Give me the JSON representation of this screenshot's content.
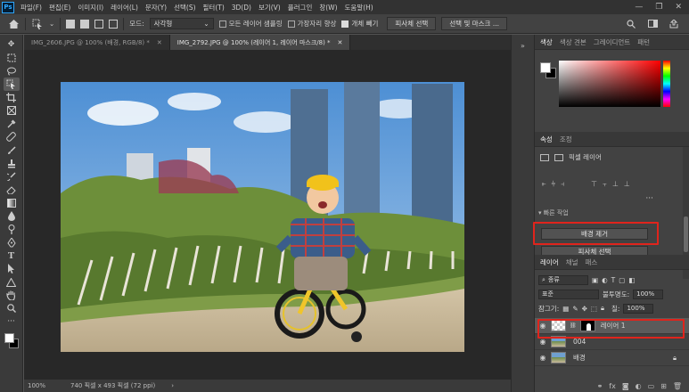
{
  "app": {
    "logo": "Ps"
  },
  "menu": [
    "파일(F)",
    "편집(E)",
    "이미지(I)",
    "레이어(L)",
    "문자(Y)",
    "선택(S)",
    "필터(T)",
    "3D(D)",
    "보기(V)",
    "플러그인",
    "창(W)",
    "도움말(H)"
  ],
  "window_controls": [
    "—",
    "❐",
    "✕"
  ],
  "options": {
    "mode_label": "모드:",
    "mode_value": "사각형",
    "sample_all_layers": "모든 레이어 샘플링",
    "enhance_edges": "가장자리 향상",
    "object_subtract": "개체 빼기",
    "select_subject": "피사체 선택",
    "select_and_mask": "선택 및 마스크 ..."
  },
  "tabs": [
    {
      "label": "IMG_2606.JPG @ 100% (배경, RGB/8) *",
      "close": "✕"
    },
    {
      "label": "IMG_2792.JPG @ 100% (레이어 1, 레이어 마스크/8) *",
      "close": "✕"
    }
  ],
  "status": {
    "zoom": "100%",
    "doc_info": "740 픽셀 x 493 픽셀 (72 ppi)",
    "arrow": "›"
  },
  "color_panel": {
    "tabs": [
      "색상",
      "색상 견본",
      "그레이디언트",
      "패턴"
    ]
  },
  "properties": {
    "tabs": [
      "속성",
      "조정"
    ],
    "layer_type": "픽셀 레이어",
    "section": "▾ 빠른 작업",
    "remove_bg_button": "배경 제거",
    "select_subject_button": "피사체 선택",
    "dots": "···"
  },
  "layers": {
    "tabs": [
      "레이어",
      "채널",
      "패스"
    ],
    "kind_label": "종류",
    "blend_mode": "표준",
    "opacity_label": "불투명도:",
    "opacity_value": "100%",
    "lock_label": "잠그기:",
    "fill_label": "칠:",
    "fill_value": "100%",
    "items": [
      {
        "name": "레이어 1",
        "selected": true
      },
      {
        "name": "004",
        "selected": false
      },
      {
        "name": "배경",
        "selected": false
      }
    ]
  },
  "colors": {
    "highlight": "#e0241c",
    "photoshop_blue": "#31a8ff"
  }
}
